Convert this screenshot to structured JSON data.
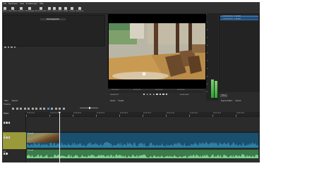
{
  "menubar": [
    "File",
    "Bearbeiten",
    "View",
    "Einstellungen",
    "Hilfe"
  ],
  "toolbar": [
    {
      "label": "Öffnen",
      "icon": "open-folder-icon"
    },
    {
      "label": "Datei öffnen",
      "icon": "open-file-icon"
    },
    {
      "label": "Speichern",
      "icon": "save-icon"
    },
    {
      "label": "Rückgängig",
      "icon": "undo-icon"
    },
    {
      "label": "Wiederherstellen",
      "icon": "redo-icon"
    },
    {
      "label": "Filter",
      "icon": "filter-icon"
    },
    {
      "label": "Verlauf",
      "icon": "history-icon"
    },
    {
      "label": "Export",
      "icon": "export-icon"
    },
    {
      "label": "Playlist",
      "icon": "playlist-icon"
    },
    {
      "label": "Timeline",
      "icon": "timeline-icon"
    },
    {
      "label": "Keyframes",
      "icon": "keyframes-icon"
    }
  ],
  "playlist": {
    "header": "Wiedergabeliste"
  },
  "left_tabs": [
    "Filter",
    "Playlist"
  ],
  "viewer": {
    "scrub_ticks": [
      "00:00:00:00",
      "00:00:01:00",
      "00:00:02:00",
      "00:00:03:00"
    ],
    "timecode": "00:00:00:12",
    "timecode_right": "00:00:15:00",
    "tabs": [
      "Quelle",
      "Projekt"
    ]
  },
  "meter": {
    "scale": [
      "0",
      "-5",
      "-10",
      "-15",
      "-20",
      "-25",
      "-30",
      "-35",
      "-40",
      "-45",
      "-50"
    ],
    "left_level": 0.22,
    "right_level": 0.2
  },
  "properties": {
    "rows": [
      "C:/Users/VIDEO/.../Clip.mp4",
      "C:/Users/VIDEO/.../Clip.mp4"
    ],
    "button": "Öffnen",
    "tabs": [
      "Eigenschaften",
      "Verlauf"
    ]
  },
  "timeline": {
    "label": "Timeline",
    "ruler": [
      "00:00:00:00",
      "00:00:02:00",
      "00:00:04:00",
      "00:00:06:00",
      "00:00:08:00",
      "00:00:10:00",
      "00:00:12:00",
      "00:00:14:00",
      "00:00:16:00",
      "00:00:18:00"
    ],
    "tracks": [
      "Master",
      "V1",
      "A1"
    ],
    "video_clip": "Clip.mp4",
    "audio_clip": "Clip.mp4"
  },
  "colors": {
    "accent": "#2d6aa3",
    "video_clip": "#1b4f6e",
    "audio_clip": "#3c7a4a",
    "track_selected": "#9a9a3a"
  }
}
